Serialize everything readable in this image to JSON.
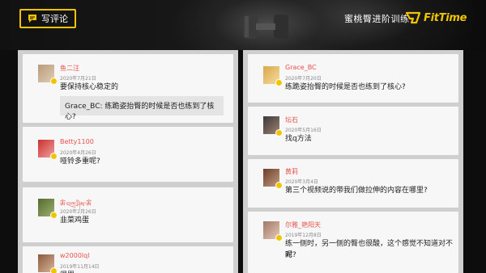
{
  "header": {
    "write_comment_label": "写评论",
    "title": "蜜桃臀进阶训练",
    "brand_name": "FitTime",
    "accent_color": "#f2c400"
  },
  "left_column": [
    {
      "username": "鱼二汪",
      "date": "2020年7月21日",
      "text": "要保持核心稳定的",
      "quote": "Grace_BC: 练跪姿抬臀的时候是否也练到了核心?"
    },
    {
      "username": "Betty1100",
      "date": "2020年4月26日",
      "text": "哑铃多重呢?"
    },
    {
      "username": "ༀ་བཀྲ་ཤིས་ༀ",
      "date": "2020年2月26日",
      "text": "韭菜鸡蛋"
    },
    {
      "username": "w2000lql",
      "date": "2019年11月14日",
      "text": "很累"
    }
  ],
  "right_column": [
    {
      "username": "Grace_BC",
      "date": "2020年7月20日",
      "text": "练跪姿抬臀的时候是否也练到了核心?"
    },
    {
      "username": "坛石",
      "date": "2020年5月16日",
      "text": "找q方法"
    },
    {
      "username": "黄莉",
      "date": "2020年3月4日",
      "text": "第三个视频说的带我们做拉伸的内容在哪里?"
    },
    {
      "username": "尔雅_艳阳天",
      "date": "2019年12月8日",
      "text_line1": "练一侧时，另一侧的臀也很酸，这个感觉不知道对不对",
      "text_line2": "呢?"
    }
  ]
}
